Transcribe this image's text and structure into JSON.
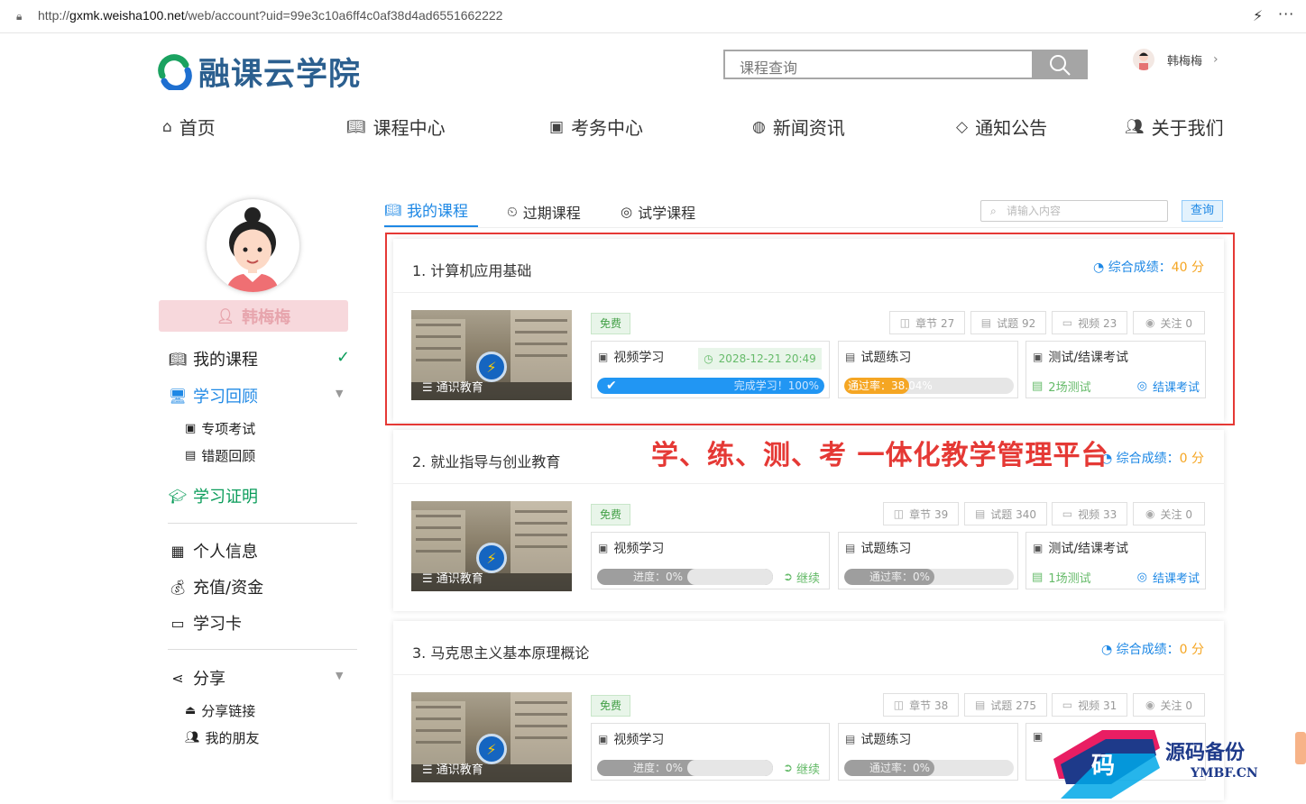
{
  "browser": {
    "url_prefix": "http://",
    "url_domain": "gxmk.weisha100.net",
    "url_path": "/web/account?uid=99e3c10a6ff4c0af38d4ad6551662222"
  },
  "header": {
    "logo_text": "融课云学院",
    "search_placeholder": "课程查询",
    "username": "韩梅梅"
  },
  "nav": [
    {
      "label": "首页",
      "icon": "home-icon"
    },
    {
      "label": "课程中心",
      "icon": "book-icon"
    },
    {
      "label": "考务中心",
      "icon": "exam-icon"
    },
    {
      "label": "新闻资讯",
      "icon": "news-icon"
    },
    {
      "label": "通知公告",
      "icon": "notice-icon"
    },
    {
      "label": "关于我们",
      "icon": "users-icon"
    }
  ],
  "sidebar": {
    "name": "韩梅梅",
    "menu": {
      "my_courses": "我的课程",
      "review": "学习回顾",
      "special_exam": "专项考试",
      "wrong_review": "错题回顾",
      "certificate": "学习证明",
      "profile": "个人信息",
      "recharge": "充值/资金",
      "study_card": "学习卡",
      "share": "分享",
      "share_link": "分享链接",
      "friends": "我的朋友"
    }
  },
  "tabs": {
    "my_courses": "我的课程",
    "expired": "过期课程",
    "trial": "试学课程",
    "search_placeholder": "请输入内容",
    "query_button": "查询"
  },
  "slogan": "学、练、测、考 一体化教学管理平台",
  "labels": {
    "score_label": "综合成绩：",
    "score_unit": " 分",
    "free": "免费",
    "video": "视频学习",
    "practice": "试题练习",
    "exam": "测试/结课考试",
    "continue": "继续",
    "final_exam": "结课考试",
    "thumb_label": "通识教育"
  },
  "courses": [
    {
      "title": "1. 计算机应用基础",
      "score": "40",
      "chapters": "章节 27",
      "questions": "试题 92",
      "videos": "视频 23",
      "follows": "关注 0",
      "video_date": "2028-12-21 20:49",
      "video_progress_text": "完成学习！100%",
      "video_progress": 1.0,
      "pass_rate_text": "通过率：38.04%",
      "pass_rate": 0.3804,
      "tests": "2场测试"
    },
    {
      "title": "2. 就业指导与创业教育",
      "score": "0",
      "chapters": "章节 39",
      "questions": "试题 340",
      "videos": "视频 33",
      "follows": "关注 0",
      "video_progress_text": "进度：0%",
      "video_progress": 0,
      "pass_rate_text": "通过率：0%",
      "pass_rate": 0,
      "tests": "1场测试"
    },
    {
      "title": "3. 马克思主义基本原理概论",
      "score": "0",
      "chapters": "章节 38",
      "questions": "试题 275",
      "videos": "视频 31",
      "follows": "关注 0",
      "video_progress_text": "进度：0%",
      "video_progress": 0,
      "pass_rate_text": "通过率：0%",
      "pass_rate": 0
    }
  ],
  "watermark": {
    "char": "码",
    "cn": "源码备份",
    "en": "YMBF.CN"
  },
  "colors": {
    "accent": "#1e88e5",
    "green": "#0a9c5a",
    "score": "#f5a623",
    "highlight": "#e53935"
  }
}
